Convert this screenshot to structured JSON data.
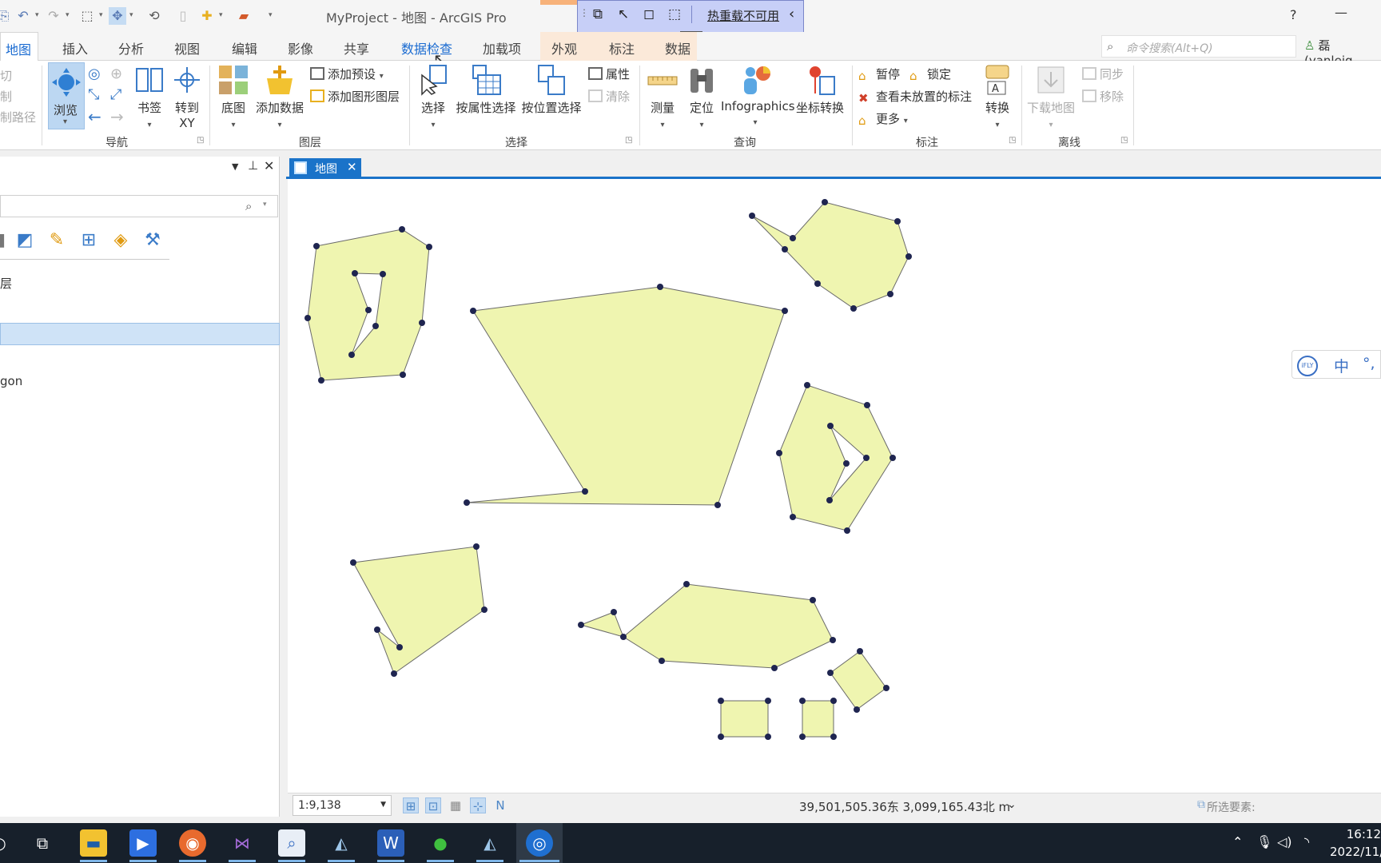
{
  "window": {
    "title": "MyProject - 地图 - ArcGIS Pro",
    "help": "?",
    "minimize": "—"
  },
  "hotreload": {
    "label": "热重载不可用",
    "collapse": "‹"
  },
  "tabs": [
    {
      "label": "地图"
    },
    {
      "label": "插入"
    },
    {
      "label": "分析"
    },
    {
      "label": "视图"
    },
    {
      "label": "编辑"
    },
    {
      "label": "影像"
    },
    {
      "label": "共享"
    },
    {
      "label": "数据检查"
    },
    {
      "label": "加载项"
    },
    {
      "label": "外观"
    },
    {
      "label": "标注"
    },
    {
      "label": "数据"
    }
  ],
  "search": {
    "placeholder": "命令搜索(Alt+Q)"
  },
  "user": {
    "name": "磊 (yanleig"
  },
  "ribbon": {
    "clipboard": {
      "items": [
        "切",
        "制",
        "制路径"
      ]
    },
    "navigate": {
      "label": "导航",
      "browse": "浏览",
      "bookmark": "书签",
      "goto_line1": "转到",
      "goto_line2": "XY"
    },
    "layer": {
      "label": "图层",
      "basemap": "底图",
      "add_data": "添加数据",
      "add_preset": "添加预设",
      "add_graphics": "添加图形图层"
    },
    "selection": {
      "label": "选择",
      "select": "选择",
      "by_attr": "按属性选择",
      "by_loc": "按位置选择",
      "attributes": "属性",
      "clear": "清除"
    },
    "inquiry": {
      "label": "查询",
      "measure": "测量",
      "locate": "定位",
      "infographics": "Infographics",
      "coord_convert": "坐标转换"
    },
    "labeling": {
      "label": "标注",
      "pause": "暂停",
      "lock": "锁定",
      "view_unplaced": "查看未放置的标注",
      "more": "更多",
      "convert": "转换"
    },
    "offline": {
      "label": "离线",
      "download": "下载地图",
      "sync": "同步",
      "remove": "移除"
    }
  },
  "left_pane": {
    "text1": "层",
    "text2": "gon"
  },
  "map_tab": {
    "label": "地图",
    "close": "✕"
  },
  "ifly": {
    "logo": "iFLY",
    "lang": "中",
    "punct": "°,"
  },
  "status": {
    "scale": "1:9,138",
    "coords": "39,501,505.36东 3,099,165.43北 m",
    "selected": "所选要素:"
  },
  "clock": {
    "time": "16:12",
    "date": "2022/11/"
  },
  "colors": {
    "accent": "#1a73c9",
    "polygon_fill": "#eff5b0",
    "vertex": "#1f2550"
  }
}
